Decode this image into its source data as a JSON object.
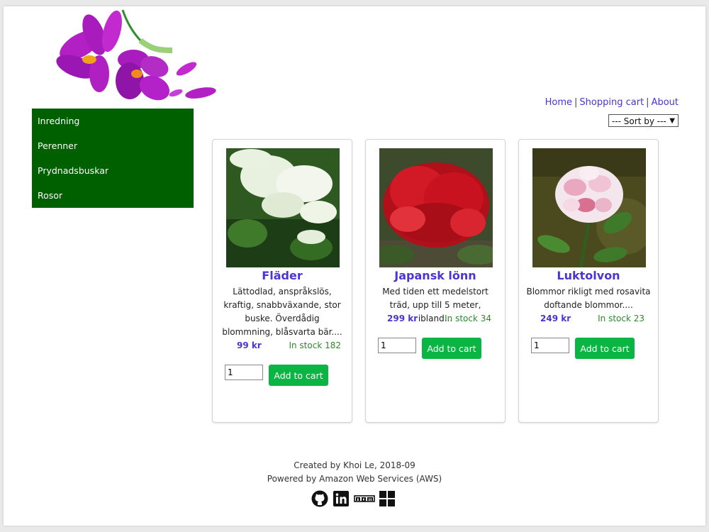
{
  "nav": {
    "home": "Home",
    "sep1": "|",
    "cart": "Shopping cart",
    "sep2": "|",
    "about": "About"
  },
  "sort": {
    "label": "--- Sort by ---",
    "arrow": "▼"
  },
  "sidebar": {
    "items": [
      {
        "label": "Inredning"
      },
      {
        "label": "Perenner"
      },
      {
        "label": "Prydnadsbuskar"
      },
      {
        "label": "Rosor"
      }
    ]
  },
  "products": [
    {
      "title": "Fläder",
      "desc": "Lättodlad, anspråkslös, kraftig, snabbväxande, stor buske. Överdådig blommning, blåsvarta bär....",
      "price": "99 kr",
      "stock": "In stock 182",
      "qty": "1",
      "button": "Add to cart"
    },
    {
      "title": "Japansk lönn",
      "desc": "Med tiden ett medelstort träd, upp till 5 meter, ibland...",
      "price": "299 kr",
      "stock": "In stock 34",
      "qty": "1",
      "button": "Add to cart"
    },
    {
      "title": "Luktolvon",
      "desc": "Blommor rikligt med rosavita doftande blommor....",
      "price": "249 kr",
      "stock": "In stock 23",
      "qty": "1",
      "button": "Add to cart"
    }
  ],
  "footer": {
    "created": "Created by Khoi Le, 2018-09",
    "powered": "Powered by Amazon Web Services (AWS)",
    "icons": [
      "github-icon",
      "linkedin-icon",
      "npm-icon",
      "windows-icon"
    ]
  },
  "colors": {
    "sidebar_bg": "#006000",
    "link": "#4a34d6",
    "button": "#0bb543",
    "stock": "#2a8a2a"
  }
}
